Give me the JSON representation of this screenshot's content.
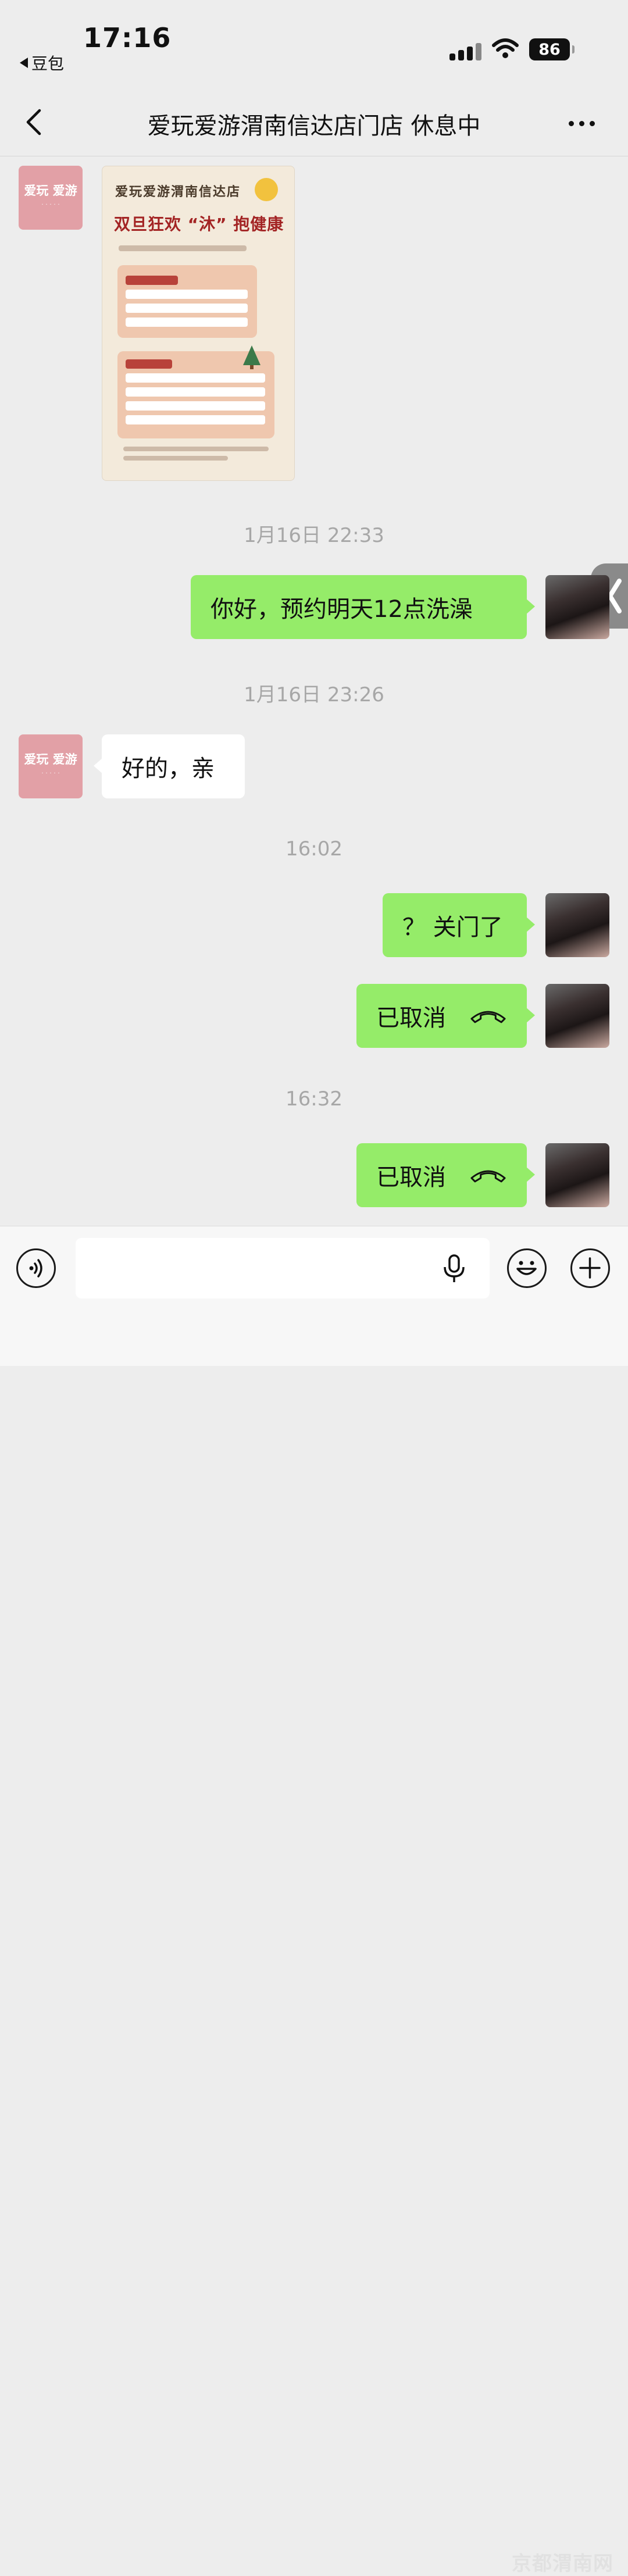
{
  "status_bar": {
    "time": "17:16",
    "back_app": "豆包",
    "battery": "86"
  },
  "nav": {
    "title": "爱玩爱游渭南信达店门店 休息中"
  },
  "shop": {
    "avatar_text": "爱玩 爱游"
  },
  "poster": {
    "title_line1": "爱玩爱游渭南信达店",
    "title_line2": "双旦狂欢 “沐” 抱健康"
  },
  "messages": {
    "ts1": "1月16日 22:33",
    "msg1": "你好，预约明天12点洗澡",
    "ts2": "1月16日 23:26",
    "msg2": "好的，亲",
    "ts3": "16:02",
    "msg3": "？ 关门了",
    "msg4": "已取消",
    "ts4": "16:32",
    "msg5": "已取消"
  },
  "input": {
    "placeholder": ""
  },
  "watermark": "京都渭南网",
  "colors": {
    "my_bubble": "#95EC69",
    "other_bubble": "#FFFFFF",
    "background": "#EDEDED"
  },
  "icons": [
    "back-chevron-icon",
    "more-icon",
    "voice-icon",
    "mic-icon",
    "emoji-icon",
    "plus-icon",
    "phone-hangup-icon",
    "signal-icon",
    "wifi-icon"
  ]
}
